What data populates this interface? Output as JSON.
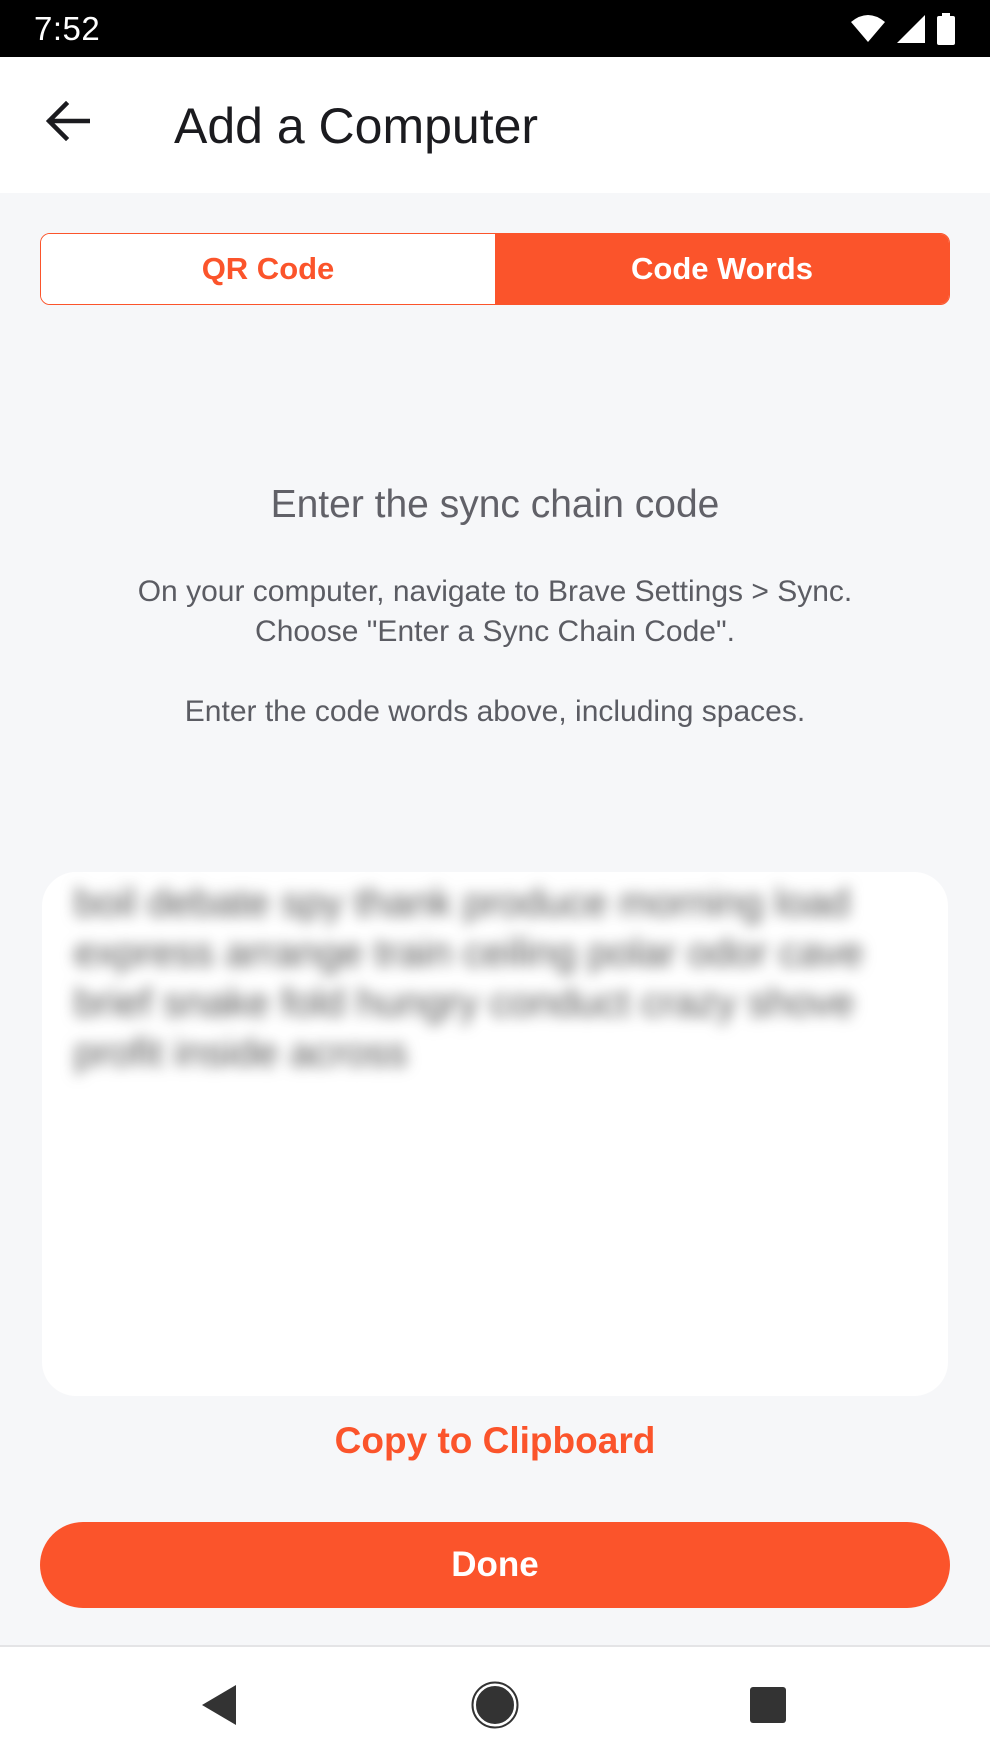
{
  "status_bar": {
    "time": "7:52",
    "icons": [
      "wifi-icon",
      "signal-icon",
      "battery-icon"
    ]
  },
  "app_bar": {
    "back_icon": "arrow-left-icon",
    "title": "Add a Computer"
  },
  "tabs": [
    {
      "label": "QR Code",
      "selected": false
    },
    {
      "label": "Code Words",
      "selected": true
    }
  ],
  "instructions": {
    "heading": "Enter the sync chain code",
    "line1": "On your computer, navigate to Brave Settings > Sync.",
    "line2": "Choose \"Enter a Sync Chain Code\".",
    "line3": "Enter the code words above, including spaces."
  },
  "code_words": {
    "text": "boil debate spy thank produce morning load express arrange train ceiling polar odor cave brief snake fold hungry conduct crazy shove profit inside across"
  },
  "actions": {
    "copy_label": "Copy to Clipboard",
    "done_label": "Done"
  },
  "nav_bar": {
    "icons": [
      "back-triangle-icon",
      "home-circle-icon",
      "recents-square-icon"
    ]
  },
  "colors": {
    "accent": "#FB542B",
    "background": "#F6F7F9",
    "text_secondary": "#5B5C63"
  }
}
